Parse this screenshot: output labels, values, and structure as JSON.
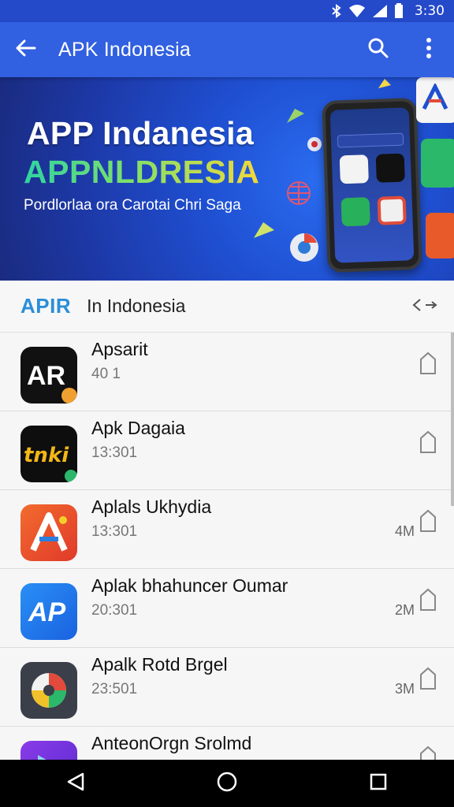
{
  "status_bar": {
    "time": "3:30",
    "icons": [
      "bluetooth-icon",
      "wifi-icon",
      "signal-icon",
      "battery-icon"
    ]
  },
  "toolbar": {
    "title": "APK Indonesia",
    "back_icon": "back-arrow-icon",
    "search_icon": "search-icon",
    "menu_icon": "more-vert-icon"
  },
  "banner": {
    "title": "APP Indanesia",
    "subtitle": "APPNLDRESIA",
    "tagline": "Pordlorlaa ora Carotai Chri Saga",
    "colors": {
      "bg": "#1f4fd1",
      "subtitle_from": "#2fd3a2",
      "subtitle_to": "#f3d83b"
    }
  },
  "section": {
    "badge": "APIR",
    "title": "In Indonesia",
    "nav_label": "<~"
  },
  "apps": [
    {
      "name": "Apsarit",
      "meta": "40 1",
      "size": "",
      "icon": "apr-logo-icon",
      "color": "#111111"
    },
    {
      "name": "Apk Dagaia",
      "meta": "13:301",
      "size": "",
      "icon": "tnki-logo-icon",
      "color": "#111111"
    },
    {
      "name": "Aplals Ukhydia",
      "meta": "13:301",
      "size": "4M",
      "icon": "a-logo-icon",
      "color": "#e8502a"
    },
    {
      "name": "Aplak bhahuncer Oumar",
      "meta": "20:301",
      "size": "2M",
      "icon": "ap-logo-icon",
      "color": "#1d7ff0"
    },
    {
      "name": "Apalk Rotd Brgel",
      "meta": "23:501",
      "size": "3M",
      "icon": "pinwheel-logo-icon",
      "color": "#3a3f4a"
    },
    {
      "name": "AnteonOrgn Srolmd",
      "meta": "",
      "size": "",
      "icon": "play-logo-icon",
      "color": "#7a3be0"
    }
  ]
}
